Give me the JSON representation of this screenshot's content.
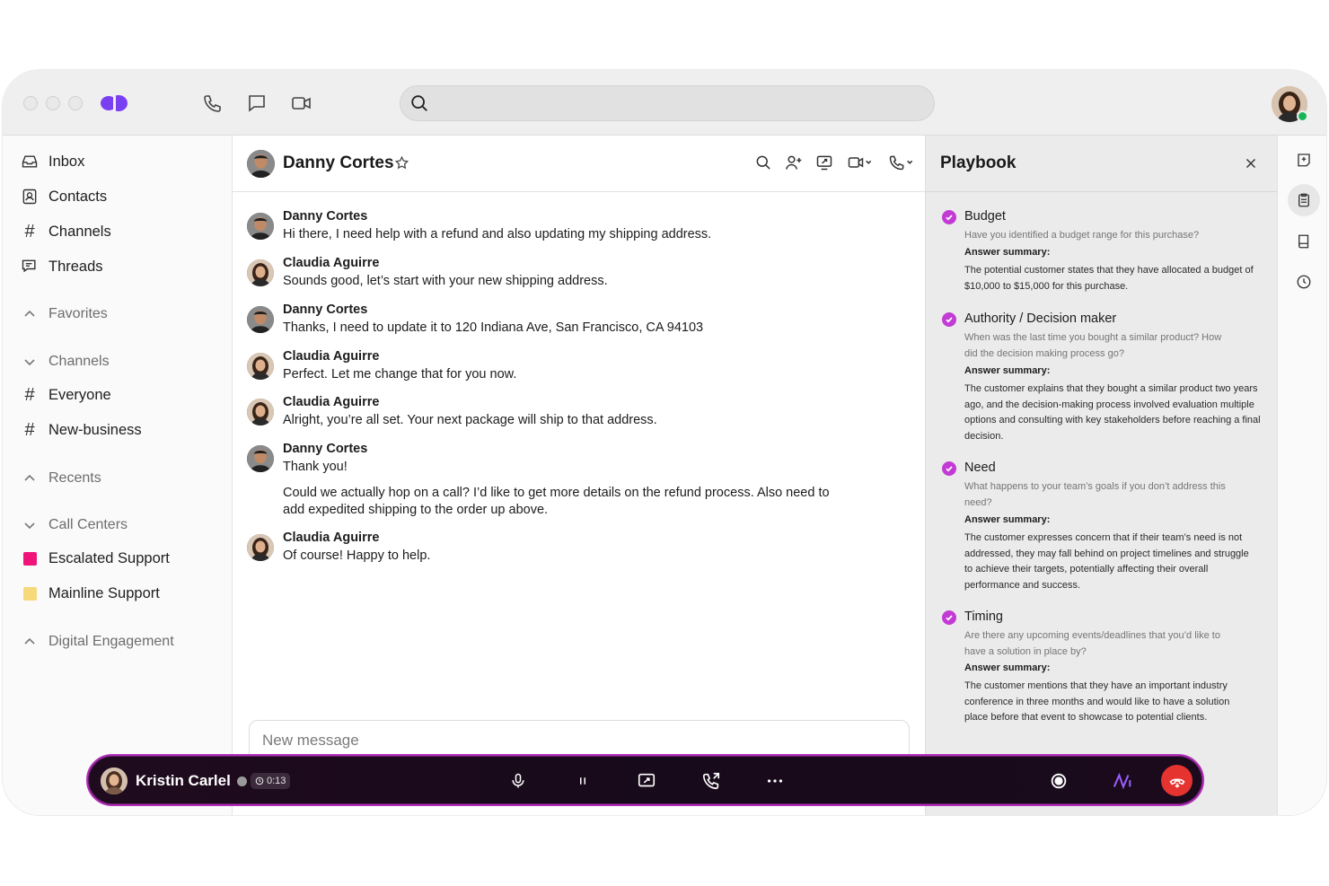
{
  "sidebar": {
    "items": [
      {
        "label": "Inbox",
        "icon": "inbox-icon"
      },
      {
        "label": "Contacts",
        "icon": "contacts-icon"
      },
      {
        "label": "Channels",
        "icon": "hash-icon"
      },
      {
        "label": "Threads",
        "icon": "threads-icon"
      }
    ],
    "favorites": "Favorites",
    "channels_section": "Channels",
    "channels": [
      "Everyone",
      "New-business"
    ],
    "recents": "Recents",
    "call_centers": "Call Centers",
    "centers": [
      {
        "label": "Escalated Support",
        "color": "#f0147a"
      },
      {
        "label": "Mainline Support",
        "color": "#f6d97a"
      }
    ],
    "digital_engagement": "Digital Engagement"
  },
  "chat": {
    "contact_name": "Danny Cortes",
    "messages": [
      {
        "author": "Danny Cortes",
        "text": "Hi there, I need help with a refund and also updating my shipping address."
      },
      {
        "author": "Claudia Aguirre",
        "text": "Sounds good, let’s start with your new shipping address."
      },
      {
        "author": "Danny Cortes",
        "text": "Thanks, I need to update it to 120 Indiana Ave, San Francisco, CA 94103"
      },
      {
        "author": "Claudia Aguirre",
        "text": "Perfect. Let me change that for you now."
      },
      {
        "author": "Claudia Aguirre",
        "text": "Alright, you’re all set. Your next package will ship to that address."
      },
      {
        "author": "Danny Cortes",
        "text": "Thank you!",
        "text2": "Could we actually hop on a call? I’d like to get more details on the refund process. Also need to add expedited shipping to the order up above."
      },
      {
        "author": "Claudia Aguirre",
        "text": "Of course! Happy to help."
      }
    ],
    "composer_placeholder": "New message"
  },
  "playbook": {
    "title": "Playbook",
    "answer_label": "Answer summary:",
    "items": [
      {
        "title": "Budget",
        "question": "Have you identified a budget range for this purchase?",
        "answer": "The potential customer states that they have allocated a budget of $10,000 to $15,000 for this purchase."
      },
      {
        "title": "Authority / Decision maker",
        "question": "When was the last time you bought a similar product? How did the decision making process go?",
        "answer": "The customer explains that they bought a similar product two years ago, and the decision-making process involved evaluation multiple options and consulting with key stakeholders before reaching a final decision."
      },
      {
        "title": "Need",
        "question": "What happens to your team’s goals if you don’t address this need?",
        "answer": "The customer expresses concern that if their team’s need is not addressed, they may fall behind on project timelines and struggle to achieve their targets, potentially affecting their overall performance and success."
      },
      {
        "title": "Timing",
        "question": "Are there any upcoming events/deadlines that you’d like to have a solution in place by?",
        "answer": "The customer mentions that they have an important industry conference in three months and would like to have a solution place before that event to showcase to potential clients."
      }
    ]
  },
  "callbar": {
    "caller_name": "Kristin Carlel",
    "timer": "0:13",
    "end_color": "#e5342f"
  },
  "colors": {
    "accent": "#7b3ff2",
    "check": "#c23bd4"
  }
}
